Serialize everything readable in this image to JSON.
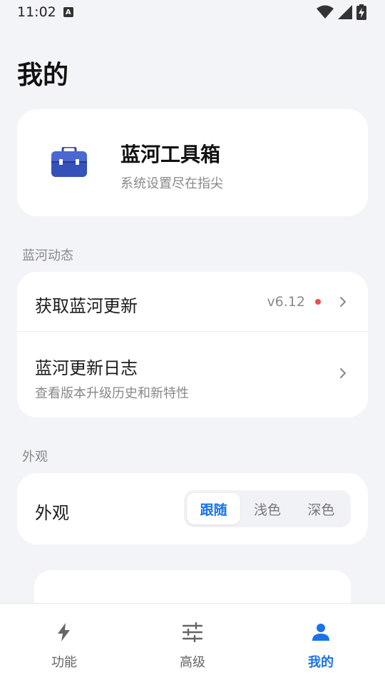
{
  "status_bar": {
    "time": "11:02",
    "notification_icon": "a-icon",
    "icons": [
      "wifi-icon",
      "signal-icon",
      "battery-charging-icon"
    ]
  },
  "page": {
    "title": "我的"
  },
  "app_card": {
    "icon": "toolbox-icon",
    "name": "蓝河工具箱",
    "tagline": "系统设置尽在指尖"
  },
  "sections": {
    "updates": {
      "label": "蓝河动态",
      "rows": [
        {
          "title": "获取蓝河更新",
          "value": "v6.12",
          "badge": "red-dot"
        },
        {
          "title": "蓝河更新日志",
          "subtitle": "查看版本升级历史和新特性"
        }
      ]
    },
    "appearance": {
      "label": "外观",
      "row_label": "外观",
      "options": [
        "跟随",
        "浅色",
        "深色"
      ],
      "selected": "跟随"
    }
  },
  "bottom_nav": {
    "items": [
      {
        "label": "功能",
        "icon": "bolt-icon"
      },
      {
        "label": "高级",
        "icon": "sliders-icon"
      },
      {
        "label": "我的",
        "icon": "person-icon"
      }
    ],
    "active": "我的"
  },
  "colors": {
    "accent": "#1a73e8",
    "background": "#f3f4f8",
    "card": "#ffffff",
    "badge": "#f24c4c",
    "toolbox": "#2e4aa8"
  }
}
